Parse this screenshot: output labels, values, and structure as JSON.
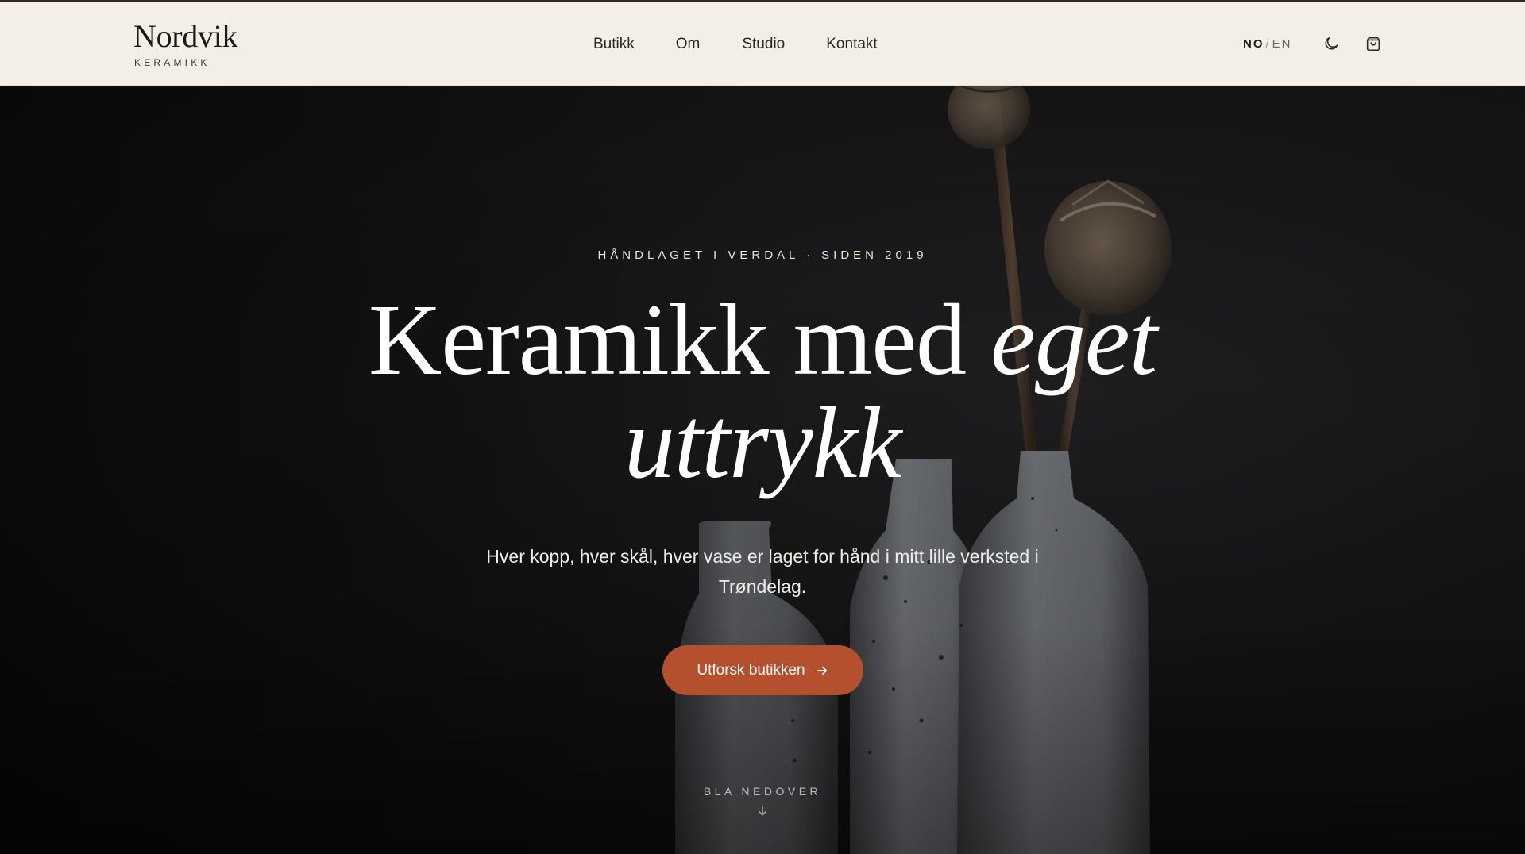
{
  "brand": {
    "name": "Nordvik",
    "subtitle": "KERAMIKK"
  },
  "nav": {
    "items": [
      {
        "label": "Butikk"
      },
      {
        "label": "Om"
      },
      {
        "label": "Studio"
      },
      {
        "label": "Kontakt"
      }
    ]
  },
  "language": {
    "active": "NO",
    "separator": "/",
    "other": "EN"
  },
  "header_icons": {
    "theme": "moon-icon",
    "cart": "shopping-bag-icon"
  },
  "hero": {
    "eyebrow": "HÅNDLAGET I VERDAL · SIDEN 2019",
    "headline_regular": "Keramikk med",
    "headline_italic_1": "eget",
    "headline_italic_2": "uttrykk",
    "lead": "Hver kopp, hver skål, hver vase er laget for hånd i mitt lille verksted i Trøndelag.",
    "cta_label": "Utforsk butikken",
    "cta_icon": "arrow-right-icon",
    "scroll_label": "BLA NEDOVER",
    "scroll_icon": "arrow-down-icon"
  },
  "colors": {
    "header_bg": "#f3efe8",
    "hero_bg": "#1c1c1d",
    "accent": "#b4502d",
    "text_dark": "#1c1a17",
    "text_light": "#ffffff"
  }
}
